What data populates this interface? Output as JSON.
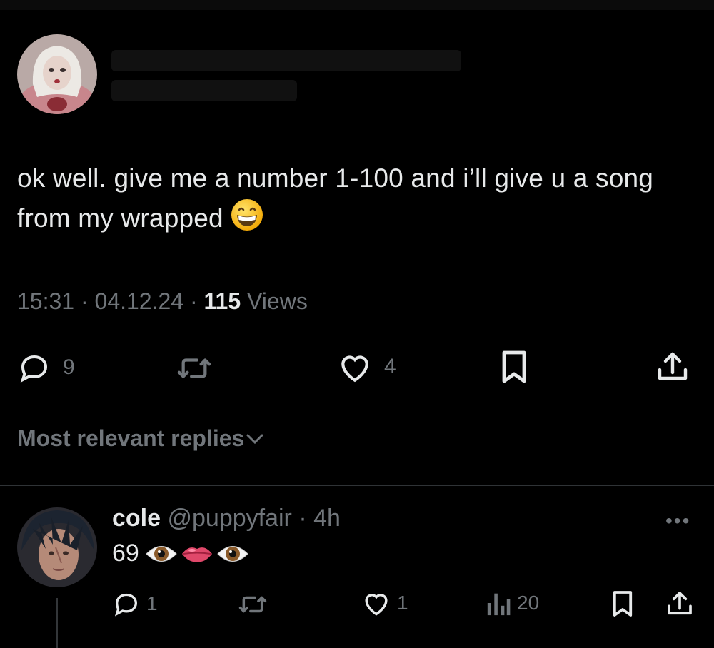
{
  "tweet": {
    "text": "ok well. give me a number 1-100 and i’ll give u a song from my wrapped",
    "emoji": "grinning-face-emoji",
    "time": "15:31",
    "date": "04.12.24",
    "views_count": "115",
    "views_label": "Views",
    "replies": "9",
    "likes": "4"
  },
  "replies_sort": {
    "label": "Most relevant replies"
  },
  "reply": {
    "name": "cole",
    "handle": "@puppyfair",
    "time": "4h",
    "text": "69",
    "emojis": [
      "eye-emoji",
      "lips-emoji",
      "eye-emoji"
    ],
    "replies": "1",
    "likes": "1",
    "views": "20"
  },
  "colors": {
    "background": "#000000",
    "text": "#e7e9ea",
    "muted": "#71767b",
    "divider": "#2f3336"
  }
}
